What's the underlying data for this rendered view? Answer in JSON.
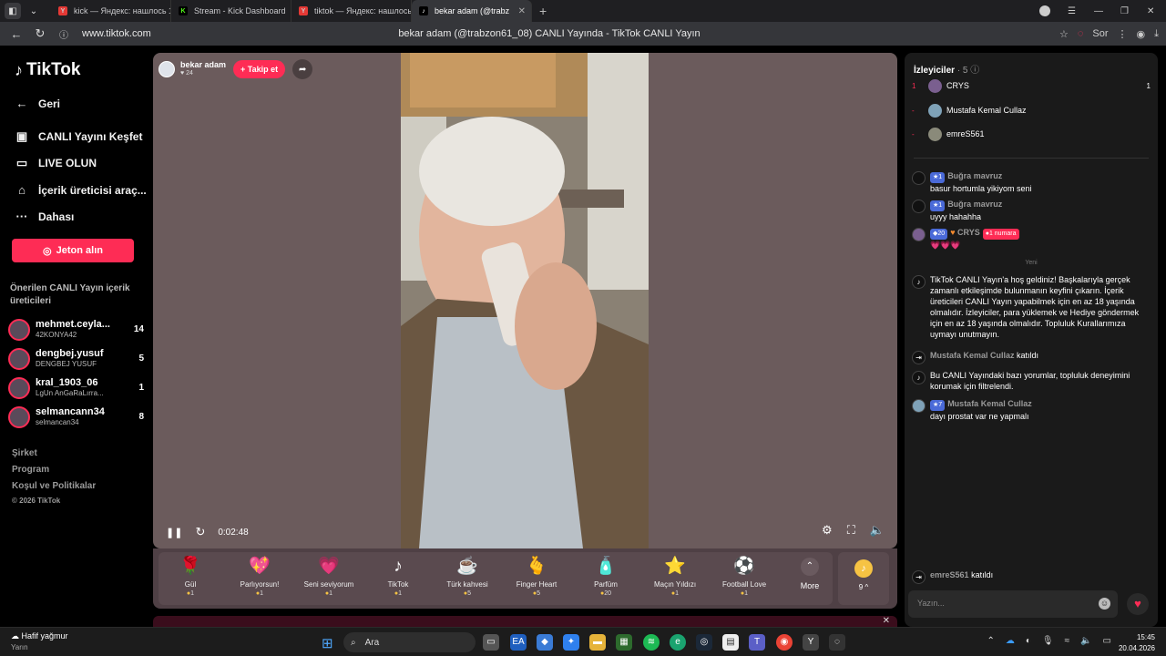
{
  "browser": {
    "tabs": [
      {
        "label": "kick — Яндекс: нашлось 1",
        "fav": "#e53935"
      },
      {
        "label": "Stream - Kick Dashboard",
        "fav": "#53fc18"
      },
      {
        "label": "tiktok — Яндекс: нашлось",
        "fav": "#e53935"
      },
      {
        "label": "bekar adam (@trabz",
        "fav": "#000000"
      }
    ],
    "url": "www.tiktok.com",
    "page_title": "bekar adam (@trabzon61_08) CANLI Yayında - TikTok CANLI Yayın",
    "sor_label": "Sor"
  },
  "sidebar": {
    "logo": "TikTok",
    "nav": [
      "Geri",
      "CANLI Yayını Keşfet",
      "LIVE OLUN",
      "İçerik üreticisi araç...",
      "Dahası"
    ],
    "jeton": "Jeton alın",
    "suggested_title": "Önerilen CANLI Yayın içerik üreticileri",
    "creators": [
      {
        "name": "mehmet.ceyla...",
        "sub": "42KONYA42",
        "count": "14"
      },
      {
        "name": "dengbej.yusuf",
        "sub": "DENGBEJ YUSUF",
        "count": "5"
      },
      {
        "name": "kral_1903_06",
        "sub": "LgUn AnGaRaLırra...",
        "count": "1"
      },
      {
        "name": "selmancann34",
        "sub": "selmancan34",
        "count": "8"
      }
    ],
    "footer": [
      "Şirket",
      "Program",
      "Koşul ve Politikalar",
      "© 2026 TikTok"
    ]
  },
  "player": {
    "host_name": "bekar adam",
    "host_likes": "24",
    "follow": "+ Takip et",
    "time": "0:02:48"
  },
  "gifts": [
    {
      "name": "Gül",
      "price": "1",
      "icon": "🌹"
    },
    {
      "name": "Parlıyorsun!",
      "price": "1",
      "icon": "💖"
    },
    {
      "name": "Seni seviyorum",
      "price": "1",
      "icon": "💗"
    },
    {
      "name": "TikTok",
      "price": "1",
      "icon": "♪"
    },
    {
      "name": "Türk kahvesi",
      "price": "5",
      "icon": "☕"
    },
    {
      "name": "Finger Heart",
      "price": "5",
      "icon": "🫰"
    },
    {
      "name": "Parfüm",
      "price": "20",
      "icon": "🧴"
    },
    {
      "name": "Maçın Yıldızı",
      "price": "1",
      "icon": "⭐"
    },
    {
      "name": "Football Love",
      "price": "1",
      "icon": "⚽"
    }
  ],
  "more_label": "More",
  "coins_label": "9 ^",
  "chat": {
    "viewers_title": "İzleyiciler",
    "viewers_count": "· 5",
    "viewers": [
      {
        "rank": "1",
        "name": "CRYS",
        "score": "1"
      },
      {
        "rank": "-",
        "name": "Mustafa Kemal Cullaz",
        "score": ""
      },
      {
        "rank": "-",
        "name": "emreS561",
        "score": ""
      }
    ],
    "messages": [
      {
        "lvl": "1",
        "user": "Buğra mavruz",
        "text": "basur hortumla yikiyom seni"
      },
      {
        "lvl": "1",
        "user": "Buğra mavruz",
        "text": "uyyy hahahha"
      },
      {
        "lvl": "20",
        "user": "CRYS",
        "badge": "1 numara",
        "text": "💗💗💗"
      }
    ],
    "yeni": "Yeni",
    "system_welcome": "TikTok CANLI Yayın'a hoş geldiniz! Başkalarıyla gerçek zamanlı etkileşimde bulunmanın keyfini çıkarın. İçerik üreticileri CANLI Yayın yapabilmek için en az 18 yaşında olmalıdır. İzleyiciler, para yüklemek ve Hediye göndermek için en az 18 yaşında olmalıdır. Topluluk Kurallarımıza uymayı unutmayın.",
    "joined1_user": "Mustafa Kemal Cullaz",
    "joined_label": "katıldı",
    "system_filter": "Bu CANLI Yayındaki bazı yorumlar, topluluk deneyimini korumak için filtrelendi.",
    "msg4": {
      "lvl": "7",
      "user": "Mustafa Kemal Cullaz",
      "text": "dayı prostat var ne yapmalı"
    },
    "joined2_user": "emreS561",
    "input_placeholder": "Yazın..."
  },
  "taskbar": {
    "weather": "Hafif yağmur",
    "weather_sub": "Yarın",
    "search": "Ara",
    "time": "15:45",
    "date": "20.04.2026"
  }
}
